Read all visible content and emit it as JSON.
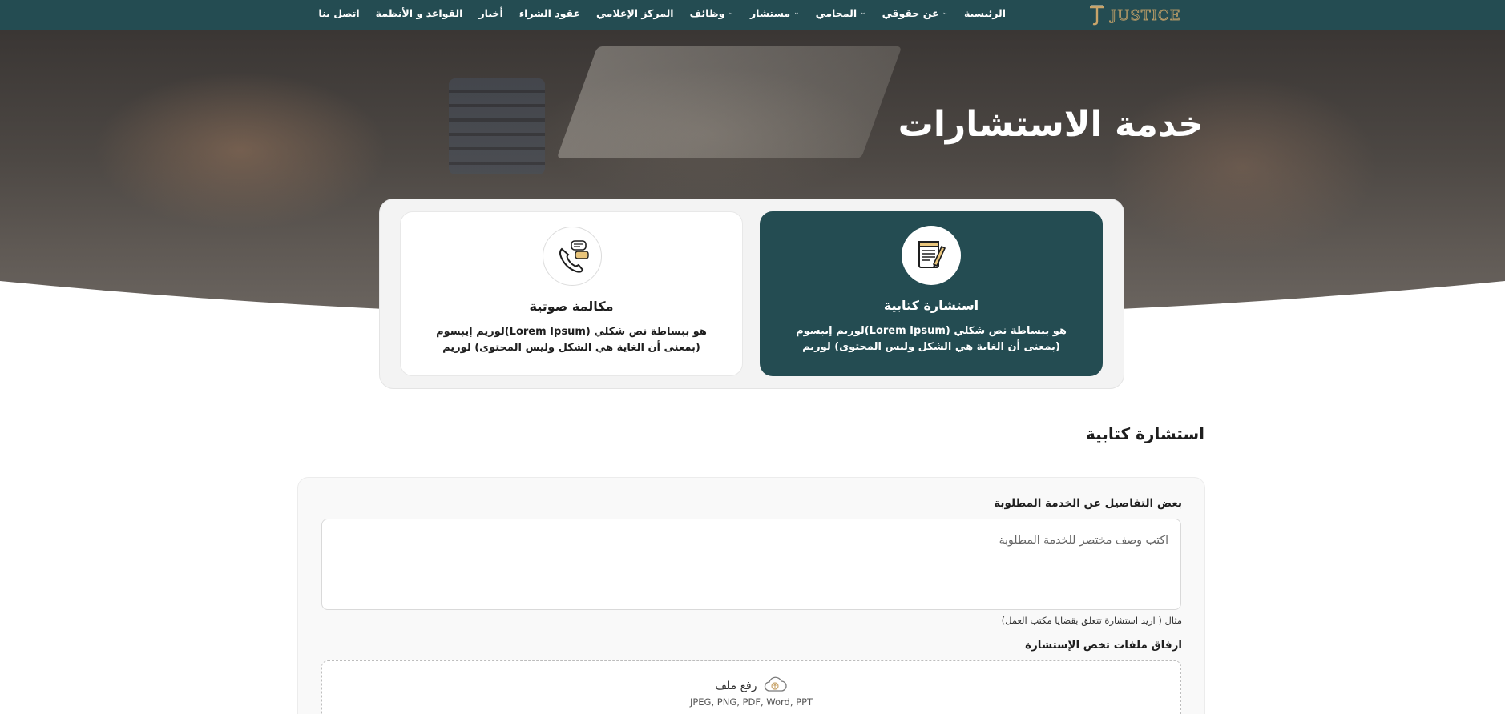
{
  "nav": {
    "logo_text": "JUSTICE",
    "items": [
      {
        "label": "الرئيسية",
        "has_dropdown": false
      },
      {
        "label": "عن حقوقي",
        "has_dropdown": true
      },
      {
        "label": "المحامي",
        "has_dropdown": true
      },
      {
        "label": "مستشار",
        "has_dropdown": true
      },
      {
        "label": "وظائف",
        "has_dropdown": true
      },
      {
        "label": "المركز الإعلامي",
        "has_dropdown": false
      },
      {
        "label": "عقود الشراء",
        "has_dropdown": false
      },
      {
        "label": "أخبار",
        "has_dropdown": false
      },
      {
        "label": "القواعد و الأنظمة",
        "has_dropdown": false
      },
      {
        "label": "اتصل بنا",
        "has_dropdown": false
      }
    ],
    "chevron_glyph": "⌄"
  },
  "hero": {
    "title": "خدمة الاستشارات"
  },
  "services": {
    "written": {
      "title": "استشارة كتابية",
      "description": "هو ببساطة نص شكلي (Lorem Ipsum)لوريم إيبسوم (بمعنى أن الغاية هي الشكل وليس المحتوى) لوريم",
      "icon": "document-pen-icon",
      "selected": true
    },
    "voice": {
      "title": "مكالمة صوتية",
      "description": "هو ببساطة نص شكلي (Lorem Ipsum)لوريم إيبسوم (بمعنى أن الغاية هي الشكل وليس المحتوى) لوريم",
      "icon": "phone-chat-icon",
      "selected": false
    }
  },
  "section": {
    "heading": "استشارة كتابية"
  },
  "form": {
    "details_label": "بعض التفاصيل عن الخدمة المطلوبة",
    "details_placeholder": "اكتب وصف مختصر للخدمة المطلوبة",
    "details_value": "",
    "hint": "مثال ( اريد استشارة تتعلق بقضايا مكتب العمل)",
    "attach_label": "ارفاق ملفات تخص الإستشارة",
    "upload_label": "رفع ملف",
    "upload_types": "JPEG, PNG, PDF, Word, PPT",
    "upload_icon": "cloud-upload-icon"
  },
  "colors": {
    "primary": "#244c52",
    "accent_gold": "#c8a46a",
    "background": "#ffffff"
  }
}
